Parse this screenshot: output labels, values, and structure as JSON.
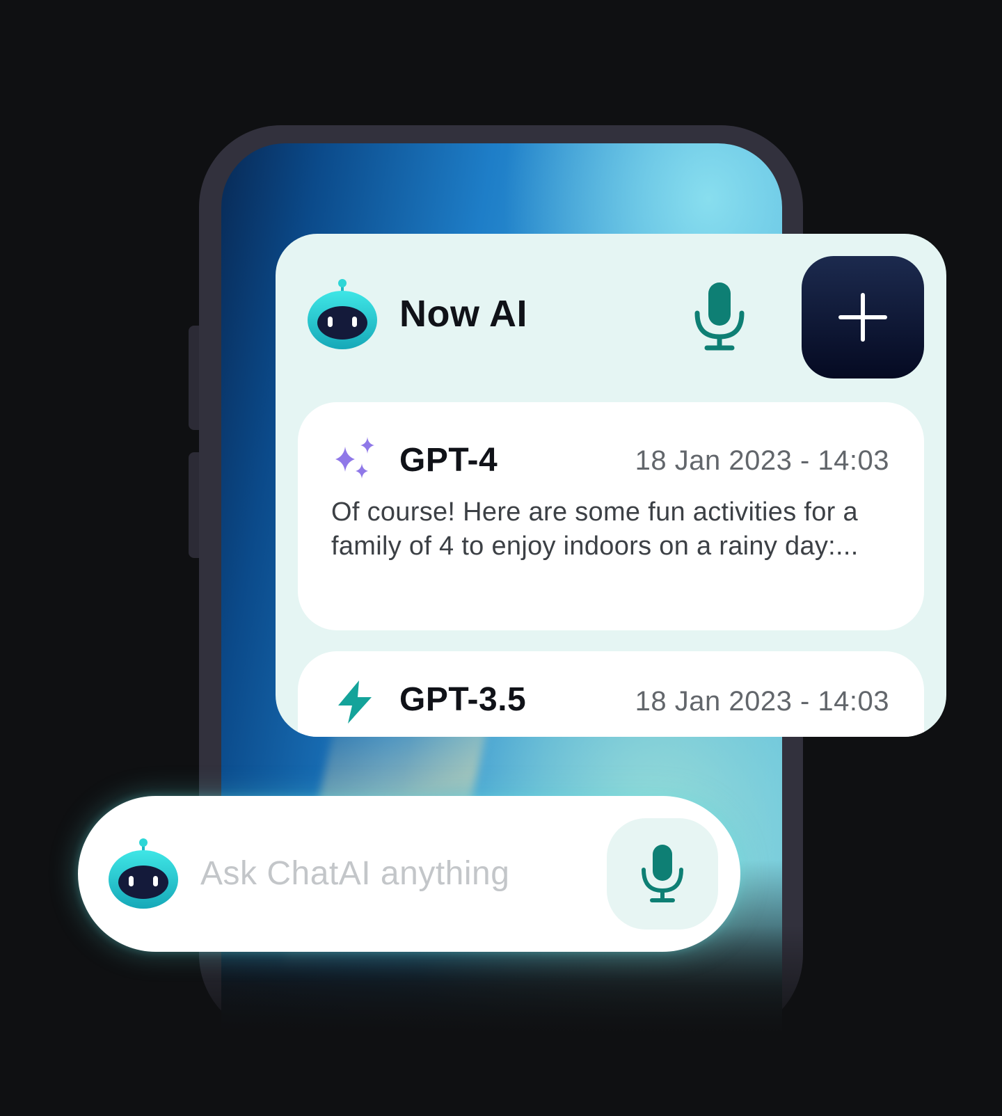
{
  "app": {
    "title": "Now AI"
  },
  "header": {
    "mic_icon": "microphone-icon",
    "add_icon": "plus-icon"
  },
  "conversations": [
    {
      "icon": "sparkles-icon",
      "model": "GPT-4",
      "timestamp": "18 Jan 2023 - 14:03",
      "preview": "Of course! Here are some fun activities for a family of 4 to enjoy indoors on a rainy day:..."
    },
    {
      "icon": "lightning-icon",
      "model": "GPT-3.5",
      "timestamp": "18 Jan 2023 - 14:03",
      "preview": ""
    }
  ],
  "input": {
    "placeholder": "Ask ChatAI anything",
    "value": "",
    "mic_icon": "microphone-icon"
  },
  "colors": {
    "background": "#0f1012",
    "phone_frame": "#32313d",
    "panel_bg": "#e5f5f3",
    "accent_teal": "#0e7f74",
    "add_button": "#0a1230",
    "sparkle_purple": "#8f78e8",
    "robot_teal": "#2ed6d6"
  }
}
